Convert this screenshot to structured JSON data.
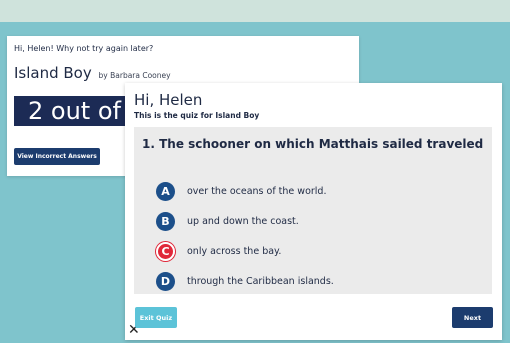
{
  "results_card": {
    "greeting": "Hi, Helen! Why not try again later?",
    "book_title": "Island Boy",
    "book_author": "by Barbara Cooney",
    "score_text": "2 out of",
    "view_incorrect_label": "View Incorrect Answers"
  },
  "quiz_card": {
    "greeting": "Hi, Helen",
    "subtitle": "This is the quiz for Island Boy",
    "question": "1. The schooner on which Matthais sailed traveled",
    "incorrect_mark": "✕",
    "answers": [
      {
        "letter": "A",
        "text": "over the oceans of the world."
      },
      {
        "letter": "B",
        "text": "up and down the coast."
      },
      {
        "letter": "C",
        "text": "only across the bay.",
        "marked_incorrect": true
      },
      {
        "letter": "D",
        "text": "through the Caribbean islands."
      }
    ],
    "exit_label": "Exit Quiz",
    "next_label": "Next"
  },
  "colors": {
    "background": "#7fc4cc",
    "navy": "#1c3c6e",
    "answer_blue": "#1c4f8a",
    "wrong_red": "#e0283a",
    "exit_cyan": "#5cc3d8"
  }
}
